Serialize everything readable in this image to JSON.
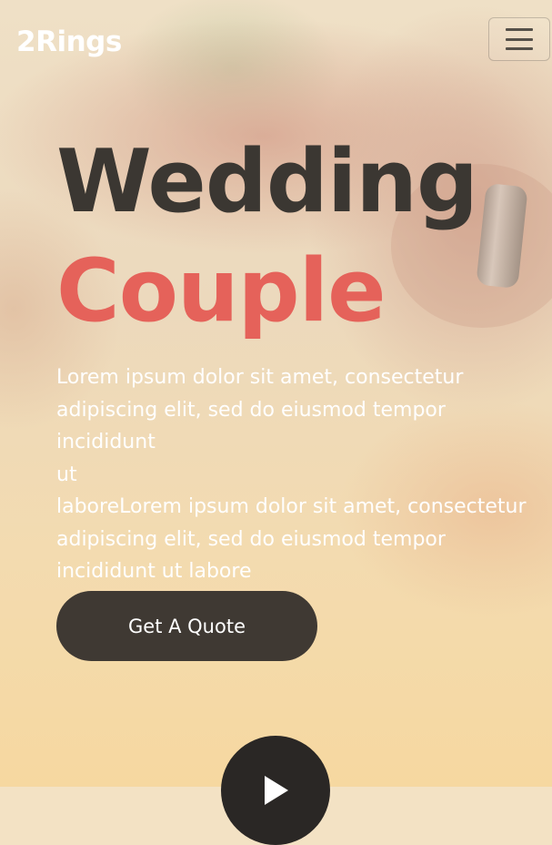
{
  "brand": {
    "name": "2Rings"
  },
  "navbar": {
    "toggler_icon": "hamburger-menu-icon"
  },
  "hero": {
    "title_line1": "Wedding",
    "title_line2": "Couple",
    "description_lines": [
      "Lorem ipsum dolor sit amet, consectetur",
      "adipiscing elit, sed do eiusmod tempor incididunt",
      "ut",
      "laboreLorem ipsum dolor sit amet, consectetur",
      "adipiscing elit, sed do eiusmod tempor",
      "incididunt ut labore"
    ],
    "cta_label": "Get A Quote",
    "play_icon": "play-icon"
  },
  "colors": {
    "title_dark": "#3b3732",
    "title_accent": "#e5625a",
    "button_bg": "#3f3933",
    "play_bg": "#2a2725"
  }
}
